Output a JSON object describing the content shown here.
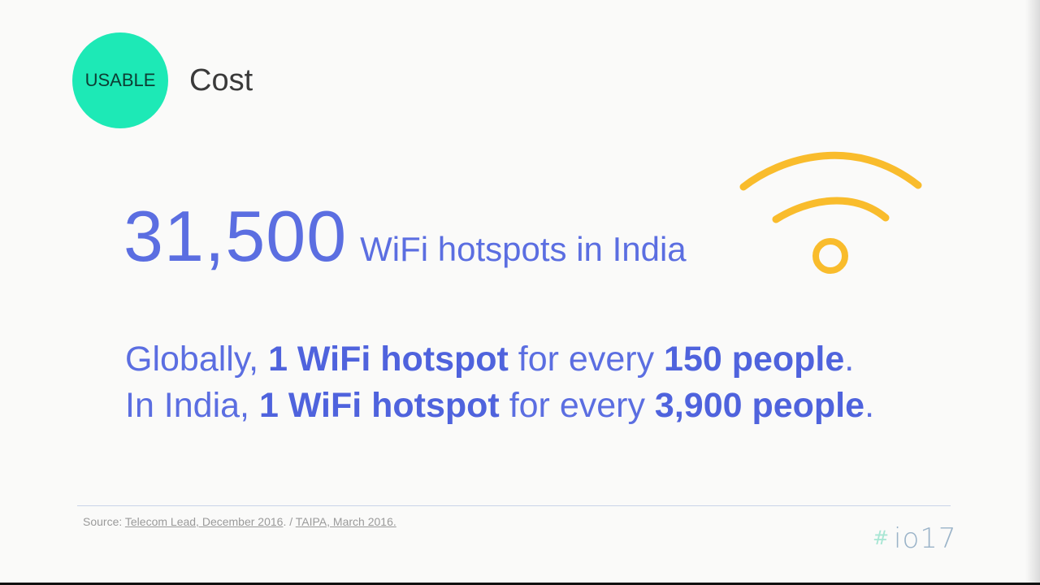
{
  "badge": {
    "label": "USABLE",
    "color": "#1de9b6"
  },
  "section_title": "Cost",
  "stat": {
    "number": "31,500",
    "caption": "WiFi hotspots in India"
  },
  "wifi_icon": "wifi-icon",
  "comparisons": {
    "global": {
      "prefix": "Globally, ",
      "hotspot": "1 WiFi hotspot",
      "middle": " for every ",
      "people": "150 people",
      "suffix": "."
    },
    "india": {
      "prefix": "In India, ",
      "hotspot": "1 WiFi hotspot",
      "middle": " for every ",
      "people": "3,900 people",
      "suffix": "."
    }
  },
  "source": {
    "prefix": "Source: ",
    "link1": "Telecom Lead, December 2016",
    "separator": ". / ",
    "link2": "TAIPA, March 2016."
  },
  "logo": {
    "hash": "#",
    "text": "io17"
  },
  "colors": {
    "accent_blue": "#5b6ee1",
    "badge_green": "#1de9b6",
    "wifi_yellow": "#f9bc2c"
  }
}
